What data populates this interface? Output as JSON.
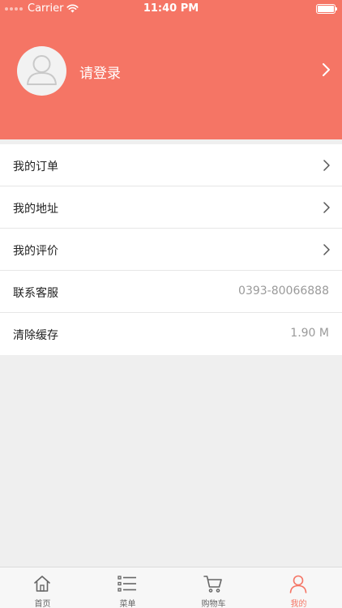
{
  "status_bar": {
    "carrier": "Carrier",
    "time": "11:40 PM"
  },
  "header": {
    "login_label": "请登录"
  },
  "menu": {
    "items": [
      {
        "label": "我的订单"
      },
      {
        "label": "我的地址"
      },
      {
        "label": "我的评价"
      },
      {
        "label": "联系客服",
        "value": "0393-80066888"
      },
      {
        "label": "清除缓存",
        "value": "1.90 M"
      }
    ]
  },
  "tabbar": {
    "tabs": [
      {
        "label": "首页",
        "icon": "home-icon"
      },
      {
        "label": "菜单",
        "icon": "list-icon"
      },
      {
        "label": "购物车",
        "icon": "cart-icon"
      },
      {
        "label": "我的",
        "icon": "user-icon"
      }
    ],
    "active_index": 3
  },
  "colors": {
    "accent": "#f57565",
    "background": "#efefef"
  }
}
